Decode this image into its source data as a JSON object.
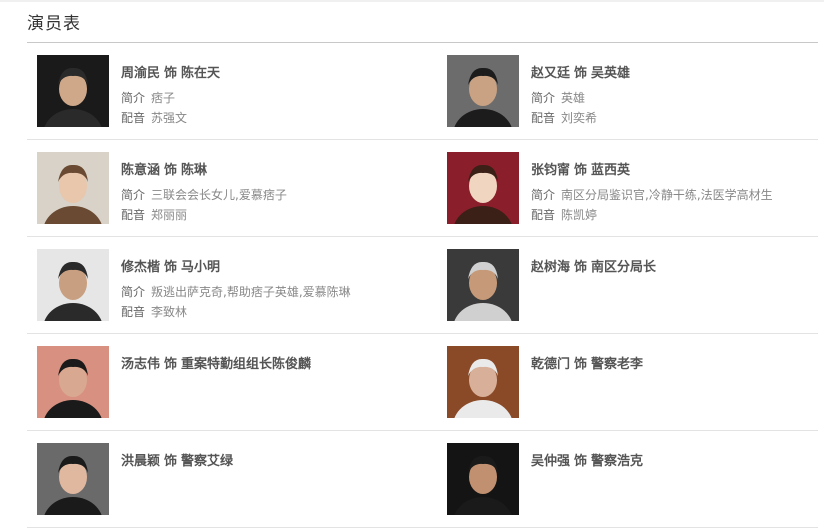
{
  "section": {
    "title": "演员表"
  },
  "labels": {
    "intro": "简介",
    "dub": "配音",
    "as": "饰"
  },
  "cast": [
    {
      "actor": "周渝民",
      "role": "陈在天",
      "intro": "痞子",
      "dub": "苏强文",
      "photo": "actor-1-portrait",
      "tone": "#2a2a2a",
      "skin": "#cfa88a",
      "bg": "#1a1a1a"
    },
    {
      "actor": "赵又廷",
      "role": "吴英雄",
      "intro": "英雄",
      "dub": "刘奕希",
      "photo": "actor-2-portrait",
      "tone": "#1c1c1c",
      "skin": "#c9a283",
      "bg": "#6c6c6c"
    },
    {
      "actor": "陈意涵",
      "role": "陈琳",
      "intro": "三联会会长女儿,爱慕痞子",
      "dub": "郑丽丽",
      "photo": "actor-3-portrait",
      "tone": "#6a4a32",
      "skin": "#e8c7ad",
      "bg": "#d8d2c8"
    },
    {
      "actor": "张钧甯",
      "role": "蓝西英",
      "intro": "南区分局鉴识官,冷静干练,法医学高材生",
      "dub": "陈凯婷",
      "photo": "actor-4-portrait",
      "tone": "#3a2016",
      "skin": "#f0d5c0",
      "bg": "#8a1e2a"
    },
    {
      "actor": "修杰楷",
      "role": "马小明",
      "intro": "叛逃出萨克奇,帮助痞子英雄,爱慕陈琳",
      "dub": "李致林",
      "photo": "actor-5-portrait",
      "tone": "#2a2a2a",
      "skin": "#c89f80",
      "bg": "#e6e6e6"
    },
    {
      "actor": "赵树海",
      "role": "南区分局长",
      "intro": "",
      "dub": "",
      "photo": "actor-6-portrait",
      "tone": "#d0d0d0",
      "skin": "#c69a78",
      "bg": "#3a3a3a"
    },
    {
      "actor": "汤志伟",
      "role": "重案特勤组组长陈俊麟",
      "intro": "",
      "dub": "",
      "photo": "actor-7-portrait",
      "tone": "#1a1a1a",
      "skin": "#d8a890",
      "bg": "#d89080"
    },
    {
      "actor": "乾德门",
      "role": "警察老李",
      "intro": "",
      "dub": "",
      "photo": "actor-8-portrait",
      "tone": "#eaeaea",
      "skin": "#d8b09a",
      "bg": "#8a4a28"
    },
    {
      "actor": "洪晨颖",
      "role": "警察艾绿",
      "intro": "",
      "dub": "",
      "photo": "actor-9-portrait",
      "tone": "#1a1a1a",
      "skin": "#e0b8a0",
      "bg": "#6a6a6a"
    },
    {
      "actor": "吴仲强",
      "role": "警察浩克",
      "intro": "",
      "dub": "",
      "photo": "actor-10-portrait",
      "tone": "#1a1a1a",
      "skin": "#c09070",
      "bg": "#141414"
    }
  ]
}
